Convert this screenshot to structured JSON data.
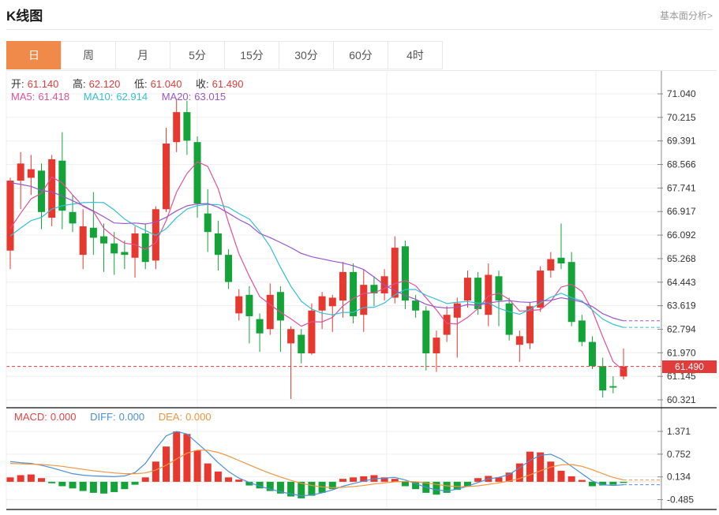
{
  "header": {
    "title": "K线图",
    "link": "基本面分析>"
  },
  "tabs": {
    "active_index": 0,
    "items": [
      "日",
      "周",
      "月",
      "5分",
      "15分",
      "30分",
      "60分",
      "4时"
    ]
  },
  "legend": {
    "open_label": "开:",
    "open": "61.140",
    "high_label": "高:",
    "high": "62.120",
    "low_label": "低:",
    "low": "61.040",
    "close_label": "收:",
    "close": "61.490",
    "ma5_label": "MA5:",
    "ma5": "61.418",
    "ma10_label": "MA10:",
    "ma10": "62.914",
    "ma20_label": "MA20:",
    "ma20": "63.015"
  },
  "macd_legend": {
    "macd_label": "MACD:",
    "macd": "0.000",
    "diff_label": "DIFF:",
    "diff": "0.000",
    "dea_label": "DEA:",
    "dea": "0.000"
  },
  "price_marker": {
    "value": "61.490",
    "numeric": 61.49
  },
  "colors": {
    "up": "#e6382e",
    "down": "#14a338",
    "ma5": "#e0509b",
    "ma10": "#32bfd4",
    "ma20": "#9a55c9",
    "diff": "#4a90d9",
    "dea": "#f0953f",
    "macd_label": "#e34444",
    "accent": "#ef8a4a",
    "price_line": "#e23b3b",
    "value_red": "#e23b3b",
    "axis_text": "#333333",
    "grid": "#efefef",
    "axis_line": "#8a8a8a",
    "panel_divider": "#333333"
  },
  "chart_data": [
    {
      "type": "candlestick",
      "title": "K线图 日",
      "legend_position": "top-left",
      "grid": true,
      "y_ticks": [
        "71.040",
        "70.215",
        "69.391",
        "68.566",
        "67.741",
        "66.917",
        "66.092",
        "65.268",
        "64.443",
        "63.619",
        "62.794",
        "61.970",
        "61.145",
        "60.321"
      ],
      "ylim": [
        60.32,
        71.04
      ],
      "last_price": 61.49,
      "ma_periods": [
        5,
        10,
        20
      ],
      "ma_seed": [
        69.8,
        69.8,
        69.8,
        69.8,
        69.8,
        69.8,
        69.8,
        69.8,
        69.8,
        69.8,
        65.8,
        65.8,
        65.8,
        65.8,
        65.8,
        65.9,
        65.9,
        65.9,
        65.9
      ],
      "candles_format": [
        "open",
        "high",
        "low",
        "close"
      ],
      "candles": [
        [
          65.55,
          68.1,
          64.9,
          68.0
        ],
        [
          68.0,
          69.0,
          67.0,
          68.6
        ],
        [
          68.1,
          68.9,
          67.5,
          68.4
        ],
        [
          68.35,
          68.6,
          66.3,
          66.9
        ],
        [
          66.7,
          68.9,
          66.4,
          68.75
        ],
        [
          68.7,
          69.7,
          66.3,
          66.95
        ],
        [
          66.9,
          67.5,
          66.2,
          66.5
        ],
        [
          65.4,
          67.0,
          64.9,
          66.4
        ],
        [
          66.35,
          67.6,
          65.4,
          66.0
        ],
        [
          66.05,
          66.5,
          64.8,
          65.8
        ],
        [
          65.8,
          66.2,
          64.7,
          65.45
        ],
        [
          65.5,
          65.9,
          64.9,
          65.4
        ],
        [
          65.3,
          66.4,
          64.6,
          66.15
        ],
        [
          66.15,
          66.5,
          64.9,
          65.15
        ],
        [
          65.2,
          67.1,
          64.9,
          67.0
        ],
        [
          67.0,
          69.85,
          66.9,
          69.3
        ],
        [
          69.35,
          70.87,
          69.0,
          70.4
        ],
        [
          70.4,
          70.8,
          68.9,
          69.4
        ],
        [
          69.35,
          69.55,
          66.7,
          67.2
        ],
        [
          66.85,
          67.7,
          65.5,
          66.2
        ],
        [
          66.15,
          66.6,
          64.85,
          65.4
        ],
        [
          65.4,
          65.6,
          64.2,
          64.45
        ],
        [
          63.35,
          64.2,
          63.1,
          63.95
        ],
        [
          64.0,
          64.3,
          62.3,
          63.25
        ],
        [
          63.15,
          63.35,
          62.0,
          62.65
        ],
        [
          62.8,
          64.4,
          62.6,
          64.0
        ],
        [
          64.1,
          64.3,
          62.0,
          63.1
        ],
        [
          62.3,
          62.9,
          60.35,
          62.8
        ],
        [
          62.6,
          62.8,
          61.6,
          61.95
        ],
        [
          61.95,
          63.7,
          61.9,
          63.45
        ],
        [
          63.45,
          64.1,
          62.8,
          63.95
        ],
        [
          63.6,
          64.0,
          62.7,
          63.9
        ],
        [
          63.8,
          65.15,
          63.2,
          64.8
        ],
        [
          64.8,
          65.1,
          63.0,
          63.25
        ],
        [
          63.3,
          64.9,
          62.7,
          64.35
        ],
        [
          64.35,
          64.65,
          63.6,
          64.05
        ],
        [
          64.05,
          64.9,
          63.8,
          64.65
        ],
        [
          63.9,
          66.05,
          63.7,
          65.65
        ],
        [
          65.7,
          65.9,
          63.5,
          63.8
        ],
        [
          63.8,
          64.0,
          63.2,
          63.45
        ],
        [
          63.45,
          63.6,
          61.35,
          61.95
        ],
        [
          61.95,
          62.75,
          61.3,
          62.5
        ],
        [
          62.6,
          63.6,
          62.35,
          63.3
        ],
        [
          63.2,
          63.9,
          61.8,
          63.7
        ],
        [
          63.8,
          64.85,
          63.55,
          64.6
        ],
        [
          64.6,
          64.8,
          63.3,
          63.5
        ],
        [
          63.3,
          65.1,
          62.9,
          64.7
        ],
        [
          64.65,
          64.85,
          62.9,
          63.8
        ],
        [
          63.7,
          63.9,
          62.4,
          62.6
        ],
        [
          62.25,
          62.75,
          61.65,
          62.55
        ],
        [
          62.3,
          63.75,
          62.1,
          63.6
        ],
        [
          63.55,
          65.0,
          63.4,
          64.85
        ],
        [
          64.85,
          65.5,
          64.6,
          65.25
        ],
        [
          65.3,
          66.5,
          64.9,
          65.1
        ],
        [
          65.15,
          65.5,
          62.9,
          63.05
        ],
        [
          63.1,
          63.3,
          62.2,
          62.35
        ],
        [
          62.35,
          62.55,
          61.4,
          61.5
        ],
        [
          61.5,
          61.8,
          60.4,
          60.65
        ],
        [
          60.8,
          61.15,
          60.55,
          60.75
        ],
        [
          61.14,
          62.12,
          61.04,
          61.49
        ]
      ]
    },
    {
      "type": "bar",
      "title": "MACD",
      "grid": true,
      "y_ticks": [
        "1.371",
        "0.752",
        "0.134",
        "-0.485"
      ],
      "ylim": [
        -0.62,
        1.5
      ],
      "histogram": [
        0.12,
        0.18,
        0.2,
        0.1,
        -0.04,
        -0.12,
        -0.18,
        -0.25,
        -0.3,
        -0.32,
        -0.28,
        -0.2,
        -0.08,
        0.12,
        0.55,
        0.96,
        1.37,
        1.3,
        0.85,
        0.5,
        0.28,
        0.12,
        0.06,
        -0.1,
        -0.18,
        -0.25,
        -0.32,
        -0.4,
        -0.45,
        -0.38,
        -0.3,
        -0.2,
        0.08,
        0.12,
        0.15,
        0.18,
        0.12,
        0.08,
        -0.12,
        -0.2,
        -0.3,
        -0.35,
        -0.3,
        -0.22,
        -0.12,
        0.1,
        0.16,
        0.12,
        0.25,
        0.5,
        0.82,
        0.8,
        0.55,
        0.3,
        0.15,
        0.05,
        -0.12,
        -0.1,
        -0.08,
        -0.03
      ],
      "series": [
        {
          "name": "DIFF",
          "values": [
            0.55,
            0.52,
            0.5,
            0.45,
            0.38,
            0.3,
            0.22,
            0.18,
            0.16,
            0.15,
            0.14,
            0.16,
            0.25,
            0.5,
            0.9,
            1.25,
            1.37,
            1.3,
            1.05,
            0.8,
            0.52,
            0.28,
            0.1,
            -0.02,
            -0.12,
            -0.2,
            -0.27,
            -0.33,
            -0.38,
            -0.36,
            -0.3,
            -0.22,
            -0.12,
            -0.05,
            0.02,
            0.08,
            0.1,
            0.12,
            0.05,
            -0.05,
            -0.15,
            -0.22,
            -0.25,
            -0.2,
            -0.12,
            -0.02,
            0.08,
            0.12,
            0.2,
            0.38,
            0.58,
            0.72,
            0.75,
            0.62,
            0.42,
            0.22,
            0.02,
            -0.08,
            -0.1,
            -0.08
          ]
        },
        {
          "name": "DEA",
          "values": [
            0.5,
            0.49,
            0.48,
            0.47,
            0.45,
            0.42,
            0.38,
            0.34,
            0.3,
            0.27,
            0.24,
            0.22,
            0.22,
            0.24,
            0.32,
            0.45,
            0.62,
            0.78,
            0.86,
            0.86,
            0.8,
            0.7,
            0.58,
            0.46,
            0.34,
            0.23,
            0.13,
            0.04,
            -0.04,
            -0.1,
            -0.14,
            -0.16,
            -0.15,
            -0.13,
            -0.1,
            -0.06,
            -0.03,
            0.0,
            0.01,
            0.0,
            -0.03,
            -0.07,
            -0.11,
            -0.13,
            -0.13,
            -0.11,
            -0.07,
            -0.03,
            0.02,
            0.09,
            0.19,
            0.3,
            0.4,
            0.46,
            0.47,
            0.42,
            0.33,
            0.22,
            0.12,
            0.05
          ]
        }
      ]
    }
  ]
}
